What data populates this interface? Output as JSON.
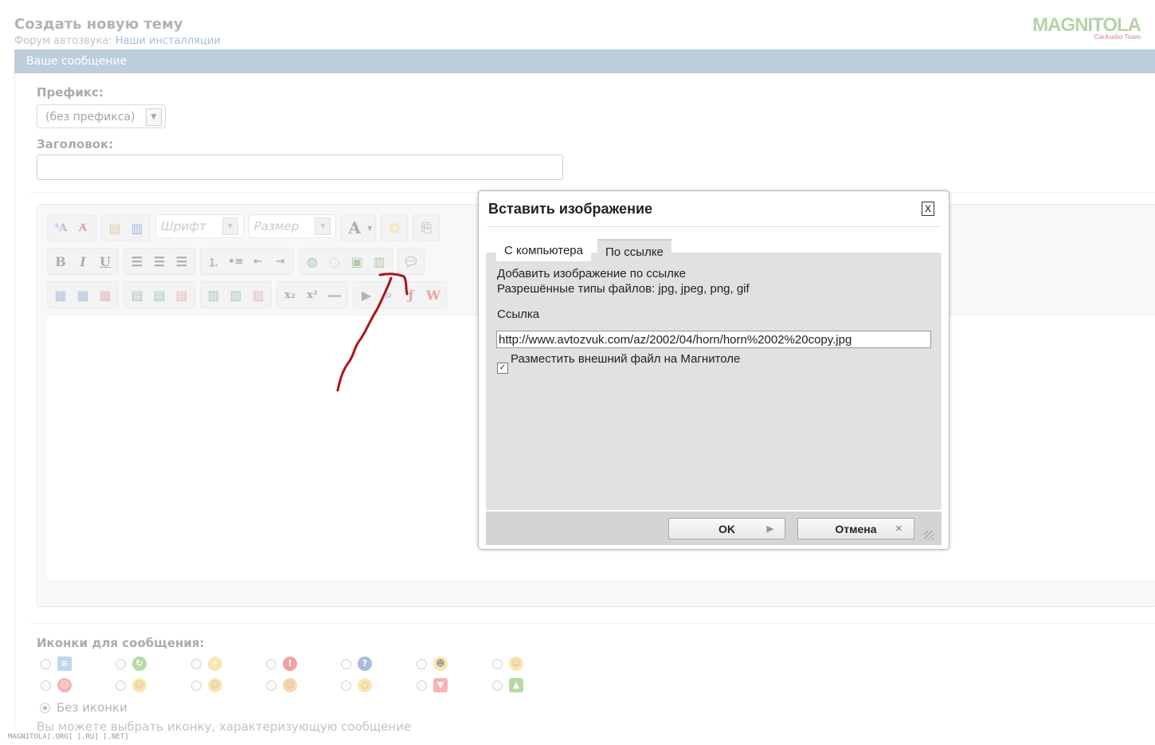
{
  "page": {
    "title": "Создать новую тему",
    "breadcrumb_prefix": "Форум автозвука:",
    "breadcrumb_link": "Наши инсталляции",
    "logo_text": "MAGNITOLA",
    "logo_sub": "CarAudio Team",
    "watermark": "MAGNITOLA[.ORG] [.RU] [.NET]"
  },
  "form": {
    "section_header": "Ваше сообщение",
    "prefix_label": "Префикс:",
    "prefix_value": "(без префикса)",
    "title_label": "Заголовок:",
    "title_value": ""
  },
  "toolbar": {
    "font_placeholder": "Шрифт",
    "size_placeholder": "Размер",
    "bold": "B",
    "italic": "I",
    "underline": "U",
    "text_color": "A",
    "subscript": "x₂",
    "superscript": "x²"
  },
  "message_icons": {
    "label": "Иконки для сообщения:",
    "no_icon_label": "Без иконки",
    "hint": "Вы можете выбрать иконку, характеризующую сообщение",
    "row1": [
      "page-icon",
      "refresh-icon",
      "lightbulb-icon",
      "exclamation-icon",
      "question-icon",
      "cool-smiley-icon",
      "smiley-icon"
    ],
    "row2": [
      "angry-icon",
      "sad-icon",
      "tongue-icon",
      "happy-icon",
      "surprised-icon",
      "thumbs-down-icon",
      "thumbs-up-icon"
    ],
    "selected": "none"
  },
  "dialog": {
    "title": "Вставить изображение",
    "close_label": "X",
    "tabs": [
      "С компьютера",
      "По ссылке"
    ],
    "active_tab": "По ссылке",
    "line1": "Добавить изображение по ссылке",
    "line2": "Разрешённые типы файлов: jpg, jpeg, png, gif",
    "url_label": "Ссылка",
    "url_value": "http://www.avtozvuk.com/az/2002/04/horn/horn%2002%20copy.jpg",
    "checkbox_label": "Разместить внешний файл на Магнитоле",
    "checkbox_checked": true,
    "ok_label": "OK",
    "cancel_label": "Отмена"
  },
  "colors": {
    "header_bar": "#6a8fb0",
    "link": "#3a6aa3",
    "annotation_arrow": "#b0121b"
  }
}
